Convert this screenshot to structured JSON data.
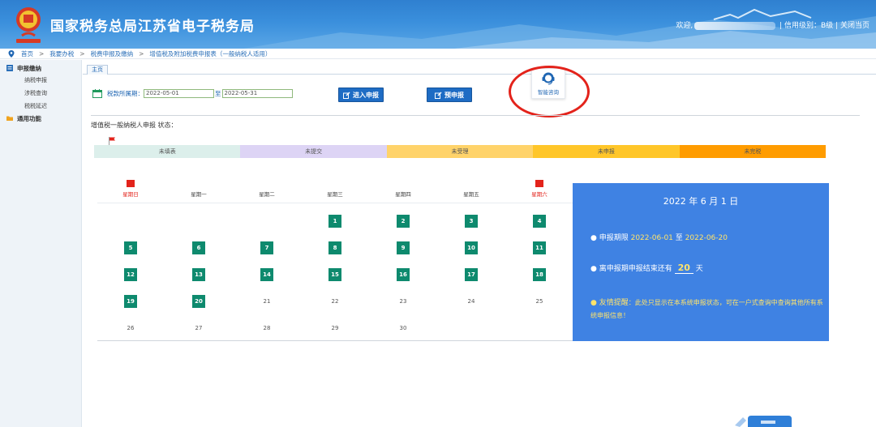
{
  "header": {
    "title": "国家税务总局江苏省电子税务局",
    "welcome": "欢迎,",
    "credit": "信用级别：B级",
    "close": "关闭当页"
  },
  "breadcrumb": [
    "首页",
    "我要办税",
    "税费申报及缴纳",
    "增值税及附加税费申报表（一般纳税人适用）"
  ],
  "sidebar": {
    "groups": [
      {
        "label": "申报缴纳",
        "items": [
          "纳税申报",
          "涉税查询",
          "税税延迟"
        ]
      },
      {
        "label": "通用功能",
        "items": []
      }
    ]
  },
  "tabs": [
    {
      "label": "主页"
    }
  ],
  "period": {
    "label": "税款所属期：",
    "start": "2022-05-01",
    "to": "至",
    "end": "2022-05-31"
  },
  "buttons": {
    "enter": "进入申报",
    "pre": "预申报"
  },
  "help": {
    "label": "智能咨询"
  },
  "status": {
    "title": "增值税一般纳税人申报 状态：",
    "steps": [
      {
        "label": "未填表",
        "color": "#dcefeb"
      },
      {
        "label": "未提交",
        "color": "#ddd4f5"
      },
      {
        "label": "未受理",
        "color": "#ffd36a"
      },
      {
        "label": "未申报",
        "color": "#ffc629"
      },
      {
        "label": "未完税",
        "color": "#ff9c00"
      }
    ]
  },
  "calendar": {
    "weekdays": [
      "星期日",
      "星期一",
      "星期二",
      "星期三",
      "星期四",
      "星期五",
      "星期六"
    ],
    "first_weekday": 3,
    "days_in_month": 30,
    "active_days": [
      1,
      2,
      3,
      4,
      5,
      6,
      7,
      8,
      9,
      10,
      11,
      12,
      13,
      14,
      15,
      16,
      17,
      18,
      19,
      20
    ],
    "accent": "#0e8a6e"
  },
  "info": {
    "date": "2022 年 6 月 1 日",
    "period_prefix": "● 申报期限",
    "period_start": "2022-06-01",
    "period_to": "至",
    "period_end": "2022-06-20",
    "remain_prefix": "● 离申报期申报结束还有",
    "remain_days": "20",
    "remain_suffix": "天",
    "tip_title": "● 友情提醒",
    "tip_text": "：此处只显示在本系统申报状态，可在一户式查询中查询其他所有系统申报信息！"
  }
}
